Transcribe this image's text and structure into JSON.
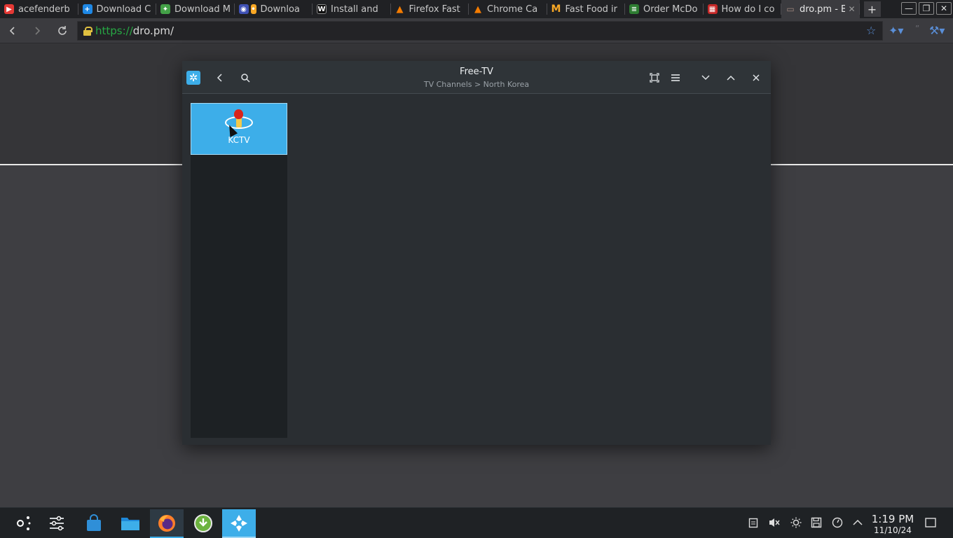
{
  "browser": {
    "tabs": [
      {
        "title": "acefenderb",
        "icon": "youtube-icon",
        "color": "#e53935"
      },
      {
        "title": "Download C",
        "icon": "plus-icon",
        "color": "#1e88e5"
      },
      {
        "title": "Download M",
        "icon": "green-star-icon",
        "color": "#43a047"
      },
      {
        "title": "Downloa",
        "icon": "gamepad-icon",
        "color": "#3f51b5"
      },
      {
        "title": "Install and",
        "icon": "wikihow-icon",
        "color": "#111111"
      },
      {
        "title": "Firefox Fast",
        "icon": "vlc-cone-icon",
        "color": "#f57c00"
      },
      {
        "title": "Chrome Ca",
        "icon": "vlc-cone-icon",
        "color": "#f57c00"
      },
      {
        "title": "Fast Food ir",
        "icon": "mcdonalds-icon",
        "color": "#f9a825"
      },
      {
        "title": "Order McDo",
        "icon": "sheet-icon",
        "color": "#2e7d32"
      },
      {
        "title": "How do I co",
        "icon": "calendar-icon",
        "color": "#c62828"
      },
      {
        "title": "dro.pm - E",
        "icon": "folder-icon",
        "color": "#8d6e63"
      }
    ],
    "close_tab_glyph": "✕",
    "new_tab_glyph": "+",
    "url_scheme": "https://",
    "url_host": "dro.pm/",
    "window_controls": [
      "—",
      "❐",
      "✕"
    ]
  },
  "app": {
    "title": "Free-TV",
    "breadcrumb": "TV Channels > North Korea",
    "channels": [
      {
        "label": "KCTV"
      }
    ]
  },
  "taskbar": {
    "time": "1:19 PM",
    "date": "11/10/24"
  },
  "colors": {
    "accent": "#3daee9",
    "secure_green": "#27a844"
  }
}
